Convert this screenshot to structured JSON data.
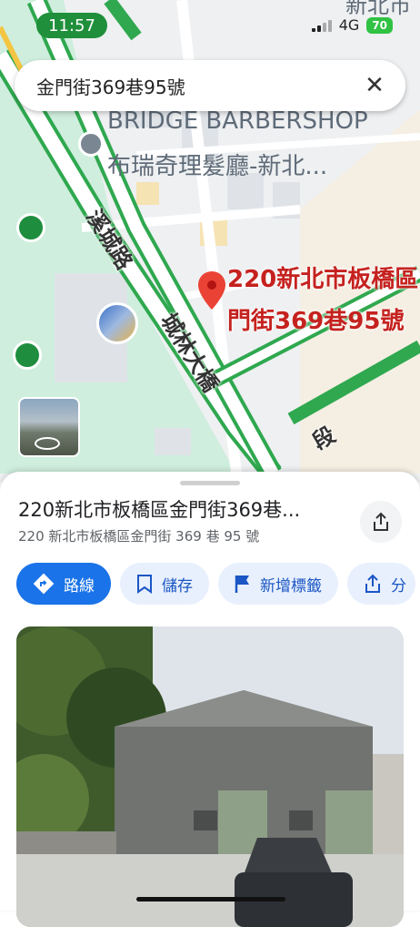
{
  "status": {
    "time": "11:57",
    "network": "4G",
    "battery": "70"
  },
  "search": {
    "query": "金門街369巷95號"
  },
  "map": {
    "business_en": "BRIDGE BARBERSHOP",
    "business_zh": "布瑞奇理髮廳-新北...",
    "top_label": "新北市",
    "road_1": "溪城路",
    "road_2": "城林大橋",
    "road_3": "段",
    "pin_label_line1": "220新北市板橋區",
    "pin_label_line2": "門街369巷95號"
  },
  "place": {
    "title": "220新北市板橋區金門街369巷...",
    "address": "220 新北市板橋區金門街 369 巷 95 號"
  },
  "actions": [
    {
      "label": "路線",
      "icon": "directions-icon"
    },
    {
      "label": "儲存",
      "icon": "bookmark-icon"
    },
    {
      "label": "新增標籤",
      "icon": "flag-icon"
    },
    {
      "label": "分",
      "icon": "share-icon"
    }
  ],
  "colors": {
    "primary": "#1a73e8",
    "pin": "#ea4335",
    "road": "#34a853"
  }
}
